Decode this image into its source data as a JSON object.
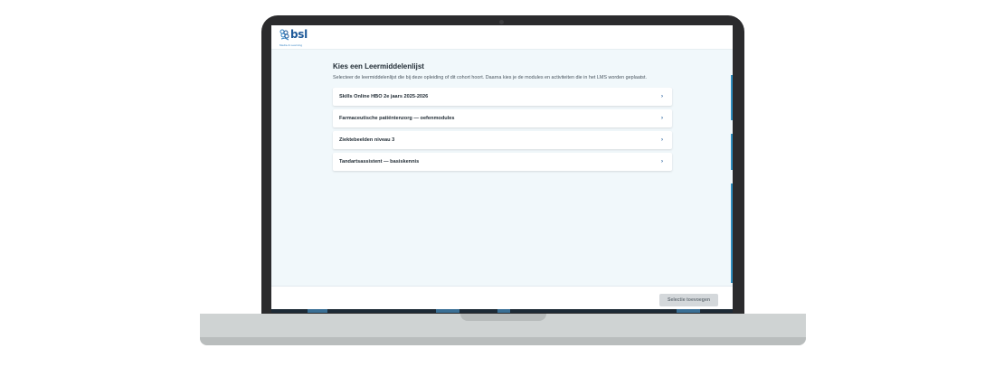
{
  "header": {
    "logo_text": "bsl",
    "logo_subtext": "Media & Learning"
  },
  "main": {
    "title": "Kies een Leermiddelenlijst",
    "description": "Selecteer de leermiddelenlijst die bij deze opleiding of dit cohort hoort. Daarna kies je de modules en activiteiten die in het LMS worden geplaatst.",
    "items": [
      {
        "label": "Skills Online HBO 2e jaars 2025-2026"
      },
      {
        "label": "Farmaceutische patiëntenzorg — oefenmodules"
      },
      {
        "label": "Ziektebeelden niveau 3"
      },
      {
        "label": "Tandartsassistent — basiskennis"
      }
    ],
    "chevron": "›"
  },
  "footer": {
    "add_button_label": "Selectie toevoegen"
  },
  "colors": {
    "brand": "#1f5a99",
    "screen_bg": "#f1f8fb",
    "button_disabled": "#d4d8db"
  },
  "icons": {
    "logo": "bsl-logo-icon",
    "chevron": "chevron-right-icon"
  }
}
